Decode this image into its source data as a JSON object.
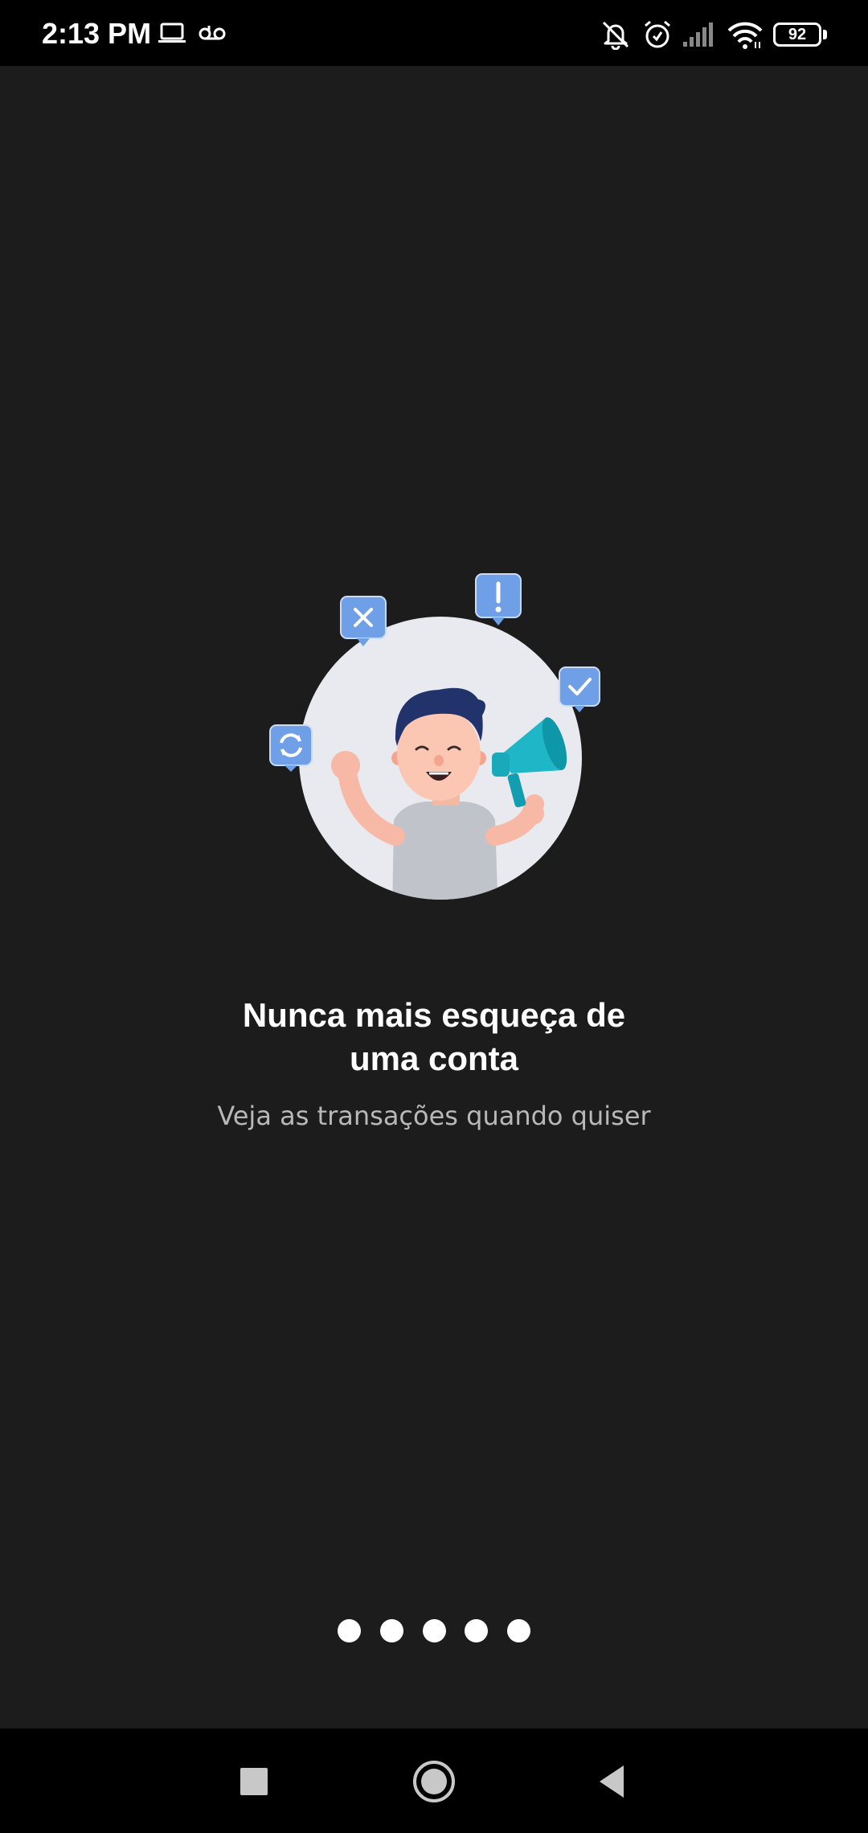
{
  "status_bar": {
    "time": "2:13 PM",
    "battery_level": "92",
    "icons": [
      "laptop-icon",
      "voicemail-icon",
      "bell-off-icon",
      "alarm-icon",
      "signal-icon",
      "wifi-icon",
      "battery-icon"
    ]
  },
  "onboarding": {
    "title_line1": "Nunca mais esqueça de",
    "title_line2": "uma conta",
    "subtitle": "Veja as transações quando quiser",
    "page_indicator": {
      "total": 5
    },
    "illustration_icons": [
      "close-bubble-icon",
      "exclamation-bubble-icon",
      "check-bubble-icon",
      "refresh-bubble-icon",
      "megaphone-icon"
    ]
  },
  "nav_bar": {
    "buttons": [
      "recents-button",
      "home-button",
      "back-button"
    ]
  },
  "colors": {
    "background": "#1c1c1c",
    "bar": "#000000",
    "accent_blue": "#6f9fe6",
    "megaphone_teal": "#1fb6c8",
    "circle_bg": "#e8eaf0"
  }
}
